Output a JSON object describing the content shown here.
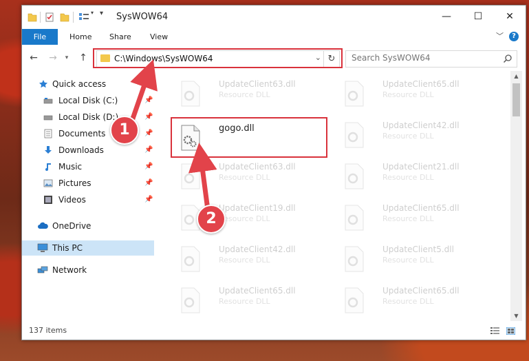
{
  "window": {
    "title": "SysWOW64",
    "minimize_glyph": "—",
    "maximize_glyph": "☐",
    "close_glyph": "✕"
  },
  "ribbon": {
    "file_label": "File",
    "home_label": "Home",
    "share_label": "Share",
    "view_label": "View",
    "help_glyph": "?"
  },
  "address": {
    "path": "C:\\Windows\\SysWOW64",
    "search_placeholder": "Search SysWOW64"
  },
  "sidebar": {
    "items": [
      {
        "label": "Quick access",
        "icon": "star-icon"
      },
      {
        "label": "Local Disk (C:)",
        "icon": "drive-icon"
      },
      {
        "label": "Local Disk (D:)",
        "icon": "drive-icon"
      },
      {
        "label": "Documents",
        "icon": "documents-icon"
      },
      {
        "label": "Downloads",
        "icon": "download-icon"
      },
      {
        "label": "Music",
        "icon": "music-icon"
      },
      {
        "label": "Pictures",
        "icon": "pictures-icon"
      },
      {
        "label": "Videos",
        "icon": "videos-icon"
      },
      {
        "label": "OneDrive",
        "icon": "cloud-icon"
      },
      {
        "label": "This PC",
        "icon": "computer-icon"
      },
      {
        "label": "Network",
        "icon": "network-icon"
      }
    ]
  },
  "files": {
    "highlighted": {
      "name": "gogo.dll"
    },
    "left_column": [
      {
        "name": "UpdateClient63.dll",
        "type": "Resource DLL"
      },
      {
        "name": "UpdateClient63.dll",
        "type": "Resource DLL"
      },
      {
        "name": "UpdateClient19.dll",
        "type": "Resource DLL"
      },
      {
        "name": "UpdateClient42.dll",
        "type": "Resource DLL"
      },
      {
        "name": "UpdateClient65.dll",
        "type": "Resource DLL"
      }
    ],
    "right_column": [
      {
        "name": "UpdateClient65.dll",
        "type": "Resource DLL"
      },
      {
        "name": "UpdateClient42.dll",
        "type": "Resource DLL"
      },
      {
        "name": "UpdateClient21.dll",
        "type": "Resource DLL"
      },
      {
        "name": "UpdateClient65.dll",
        "type": "Resource DLL"
      },
      {
        "name": "UpdateClient5.dll",
        "type": "Resource DLL"
      },
      {
        "name": "UpdateClient65.dll",
        "type": "Resource DLL"
      }
    ]
  },
  "status": {
    "item_count": "137 items"
  },
  "callouts": {
    "step1": "1",
    "step2": "2"
  },
  "colors": {
    "accent": "#1979ca",
    "highlight": "#d9313b",
    "callout": "#e2434a",
    "folder": "#f3c84c",
    "selected": "#cce4f7"
  }
}
